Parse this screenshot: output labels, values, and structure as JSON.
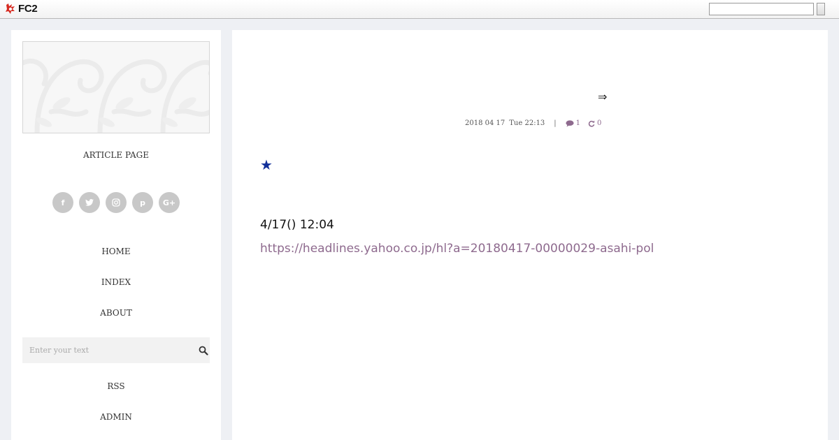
{
  "topbar": {
    "logo_text": "FC2",
    "search_value": ""
  },
  "sidebar": {
    "blog_title": "ARTICLE PAGE",
    "social": [
      {
        "icon": "facebook-icon",
        "glyph": "f"
      },
      {
        "icon": "twitter-icon",
        "glyph": "t"
      },
      {
        "icon": "instagram-icon",
        "glyph": "◎"
      },
      {
        "icon": "pinterest-icon",
        "glyph": "p"
      },
      {
        "icon": "google-plus-icon",
        "glyph": "G+"
      }
    ],
    "nav": [
      "HOME",
      "INDEX",
      "ABOUT"
    ],
    "search_placeholder": "Enter your text",
    "footer_nav": [
      "RSS",
      "ADMIN"
    ]
  },
  "article": {
    "title_glyph": "⇒",
    "date": "2018 04 17",
    "weekday_time": "Tue 22:13",
    "separator": "|",
    "comment_count": "1",
    "trackback_count": "0",
    "star": "★",
    "post_date": "4/17() 12:04",
    "link_text": "https://headlines.yahoo.co.jp/hl?a=20180417-00000029-asahi-pol"
  },
  "colors": {
    "link": "#8e6a8e",
    "star": "#12309a",
    "background": "#eef0f4"
  }
}
